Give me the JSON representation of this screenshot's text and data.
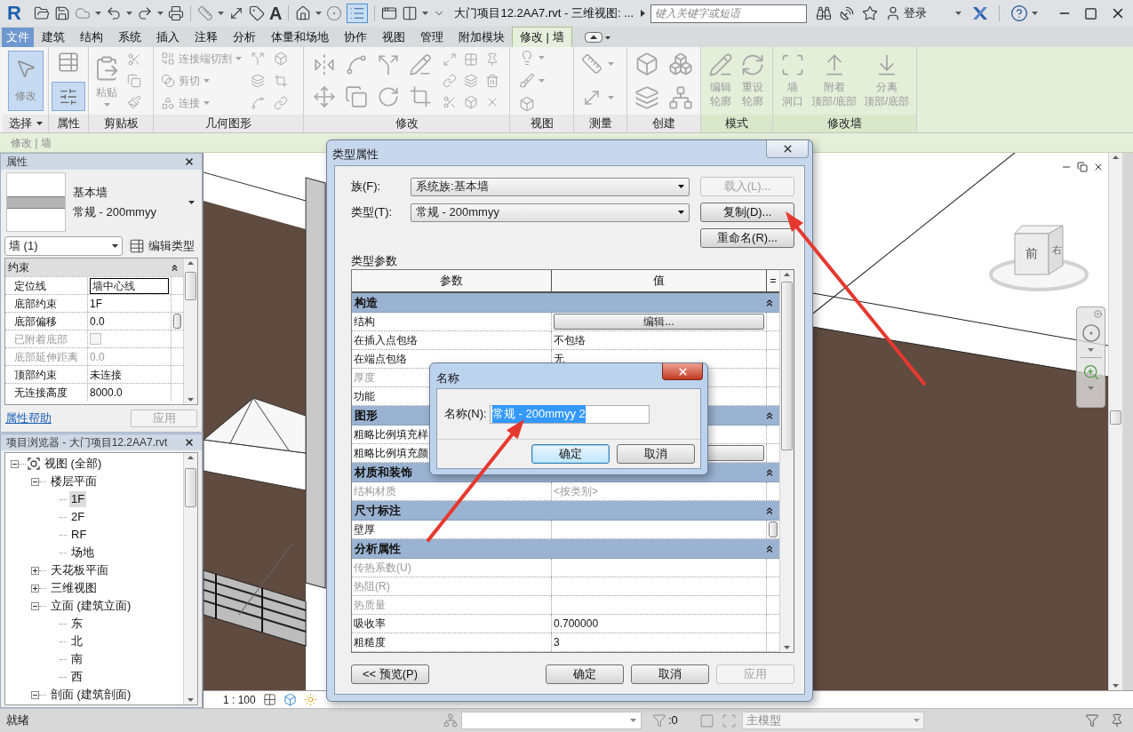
{
  "title_bar": {
    "logo": "R",
    "title": "大门项目12.2AA7.rvt - 三维视图: ...",
    "search": {
      "placeholder": "键入关键字或短语"
    },
    "sign_in": "登录"
  },
  "quick_access": {
    "text_tool": "A",
    "thin_lines": true
  },
  "ribbon": {
    "file_tab": "文件",
    "tabs": [
      {
        "label": "建筑",
        "selected": false
      },
      {
        "label": "结构",
        "selected": false
      },
      {
        "label": "系统",
        "selected": false
      },
      {
        "label": "插入",
        "selected": false
      },
      {
        "label": "注释",
        "selected": false
      },
      {
        "label": "分析",
        "selected": false
      },
      {
        "label": "体量和场地",
        "selected": false
      },
      {
        "label": "协作",
        "selected": false
      },
      {
        "label": "视图",
        "selected": false
      },
      {
        "label": "管理",
        "selected": false
      },
      {
        "label": "附加模块",
        "selected": false
      },
      {
        "label": "修改 | 墙",
        "selected": true
      }
    ],
    "panels": [
      {
        "kind": "select",
        "label": "选择",
        "contextual": false,
        "tools": [
          {
            "label": "修改",
            "selected": true
          }
        ]
      },
      {
        "kind": "properties",
        "label": "属性",
        "contextual": false,
        "tools": [
          {
            "selected": true
          }
        ]
      },
      {
        "kind": "clipboard",
        "label": "剪贴板",
        "contextual": false,
        "tools": [
          {
            "label": "粘贴",
            "disabled": true
          }
        ]
      },
      {
        "kind": "geometry",
        "label": "几何图形",
        "contextual": false,
        "tools": [
          {
            "label": "连接端切割",
            "disabled": true
          },
          {
            "label": "剪切",
            "disabled": true
          },
          {
            "label": "连接",
            "disabled": true
          }
        ]
      },
      {
        "kind": "modify",
        "label": "修改",
        "contextual": false
      },
      {
        "kind": "view",
        "label": "视图",
        "contextual": false
      },
      {
        "kind": "measure",
        "label": "测量",
        "contextual": false
      },
      {
        "kind": "create",
        "label": "创建",
        "contextual": false
      },
      {
        "kind": "mode",
        "label": "模式",
        "contextual": true,
        "tools": [
          {
            "lines": [
              "编辑",
              "轮廓"
            ],
            "disabled": true
          },
          {
            "lines": [
              "重设",
              "轮廓"
            ],
            "disabled": true
          }
        ]
      },
      {
        "kind": "modify_wall",
        "label": "修改墙",
        "contextual": true,
        "tools": [
          {
            "lines": [
              "墙",
              "洞口"
            ],
            "disabled": true
          },
          {
            "lines": [
              "附着",
              "顶部/底部"
            ],
            "disabled": true
          },
          {
            "lines": [
              "分离",
              "顶部/底部"
            ],
            "disabled": true
          }
        ]
      }
    ]
  },
  "options_bar": {
    "label": "修改 | 墙"
  },
  "properties": {
    "title": "属性",
    "type_family": "基本墙",
    "type_name": "常规 - 200mmyy",
    "instance_filter": "墙 (1)",
    "edit_type": "编辑类型",
    "groups": [
      {
        "label": "约束",
        "expanded": true,
        "rows": [
          {
            "kind": "field",
            "name": "定位线",
            "value": "墙中心线",
            "disabled": false
          },
          {
            "kind": "text",
            "name": "底部约束",
            "value": "1F",
            "disabled": false
          },
          {
            "kind": "text",
            "name": "底部偏移",
            "value": "0.0",
            "disabled": false,
            "associate": true
          },
          {
            "kind": "checkbox",
            "name": "已附着底部",
            "checked": false,
            "disabled": true
          },
          {
            "kind": "text",
            "name": "底部延伸距离",
            "value": "0.0",
            "disabled": true
          },
          {
            "kind": "text",
            "name": "顶部约束",
            "value": "未连接",
            "disabled": false
          },
          {
            "kind": "text",
            "name": "无连接高度",
            "value": "8000.0",
            "disabled": false
          }
        ]
      }
    ],
    "help_link": "属性帮助",
    "apply": {
      "label": "应用",
      "disabled": true
    }
  },
  "project_browser": {
    "title": "项目浏览器 - 大门项目12.2AA7.rvt",
    "tree": [
      {
        "label": "视图 (全部)",
        "selected": false,
        "expanded": true,
        "children": [
          {
            "label": "楼层平面",
            "selected": false,
            "expanded": true,
            "children": [
              {
                "label": "1F",
                "selected": true
              },
              {
                "label": "2F",
                "selected": false
              },
              {
                "label": "RF",
                "selected": false
              },
              {
                "label": "场地",
                "selected": false
              }
            ]
          },
          {
            "label": "天花板平面",
            "selected": false,
            "expanded": false
          },
          {
            "label": "三维视图",
            "selected": false,
            "expanded": false
          },
          {
            "label": "立面 (建筑立面)",
            "selected": false,
            "expanded": true,
            "children": [
              {
                "label": "东",
                "selected": false
              },
              {
                "label": "北",
                "selected": false
              },
              {
                "label": "南",
                "selected": false
              },
              {
                "label": "西",
                "selected": false
              }
            ]
          },
          {
            "label": "剖面 (建筑剖面)",
            "selected": false,
            "expanded": true
          }
        ]
      }
    ]
  },
  "viewport": {
    "view_cube_faces": [
      "前",
      "右"
    ],
    "scale": "1 : 100"
  },
  "type_properties": {
    "title": "类型属性",
    "family": {
      "label": "族(F):",
      "value": "系统族:基本墙"
    },
    "type": {
      "label": "类型(T):",
      "value": "常规 - 200mmyy"
    },
    "side_buttons": [
      {
        "label": "载入(L)...",
        "disabled": true
      },
      {
        "label": "复制(D)...",
        "disabled": false
      },
      {
        "label": "重命名(R)...",
        "disabled": false
      }
    ],
    "parameters_label": "类型参数",
    "columns": [
      "参数",
      "值",
      "="
    ],
    "groups": [
      {
        "label": "构造",
        "expanded": true,
        "rows": [
          {
            "kind": "button",
            "name": "结构",
            "value": "编辑...",
            "disabled": false
          },
          {
            "kind": "text",
            "name": "在插入点包络",
            "value": "不包络",
            "disabled": false
          },
          {
            "kind": "text",
            "name": "在端点包络",
            "value": "无",
            "disabled": false
          },
          {
            "kind": "text",
            "name": "厚度",
            "disabled": true
          },
          {
            "kind": "text",
            "name": "功能",
            "disabled": false
          }
        ]
      },
      {
        "label": "图形",
        "expanded": true,
        "rows": [
          {
            "kind": "text",
            "name": "粗略比例填充样",
            "disabled": false
          },
          {
            "kind": "button",
            "name": "粗略比例填充颜",
            "disabled": false
          }
        ]
      },
      {
        "label": "材质和装饰",
        "expanded": true,
        "rows": [
          {
            "kind": "text",
            "name": "结构材质",
            "value": "<按类别>",
            "disabled": true
          }
        ]
      },
      {
        "label": "尺寸标注",
        "expanded": true,
        "rows": [
          {
            "kind": "text",
            "name": "壁厚",
            "disabled": false,
            "associate": true
          }
        ]
      },
      {
        "label": "分析属性",
        "expanded": true,
        "rows": [
          {
            "kind": "text",
            "name": "传热系数(U)",
            "disabled": true
          },
          {
            "kind": "text",
            "name": "热阻(R)",
            "disabled": true
          },
          {
            "kind": "text",
            "name": "热质量",
            "disabled": true
          },
          {
            "kind": "text",
            "name": "吸收率",
            "value": "0.700000",
            "disabled": false
          },
          {
            "kind": "text",
            "name": "粗糙度",
            "value": "3",
            "disabled": false
          }
        ]
      }
    ],
    "footer_buttons": [
      {
        "label": "<< 预览(P)",
        "disabled": false
      },
      {
        "label": "确定",
        "disabled": false
      },
      {
        "label": "取消",
        "disabled": false
      },
      {
        "label": "应用",
        "disabled": true
      }
    ]
  },
  "name_dialog": {
    "title": "名称",
    "label": "名称(N):",
    "value": "常规 - 200mmyy 2",
    "value_selected": true,
    "buttons": [
      {
        "label": "确定",
        "default": true
      },
      {
        "label": "取消",
        "default": false
      }
    ]
  },
  "status_bar": {
    "message": "就绪",
    "filter_count": ":0",
    "workset": "主模型"
  }
}
